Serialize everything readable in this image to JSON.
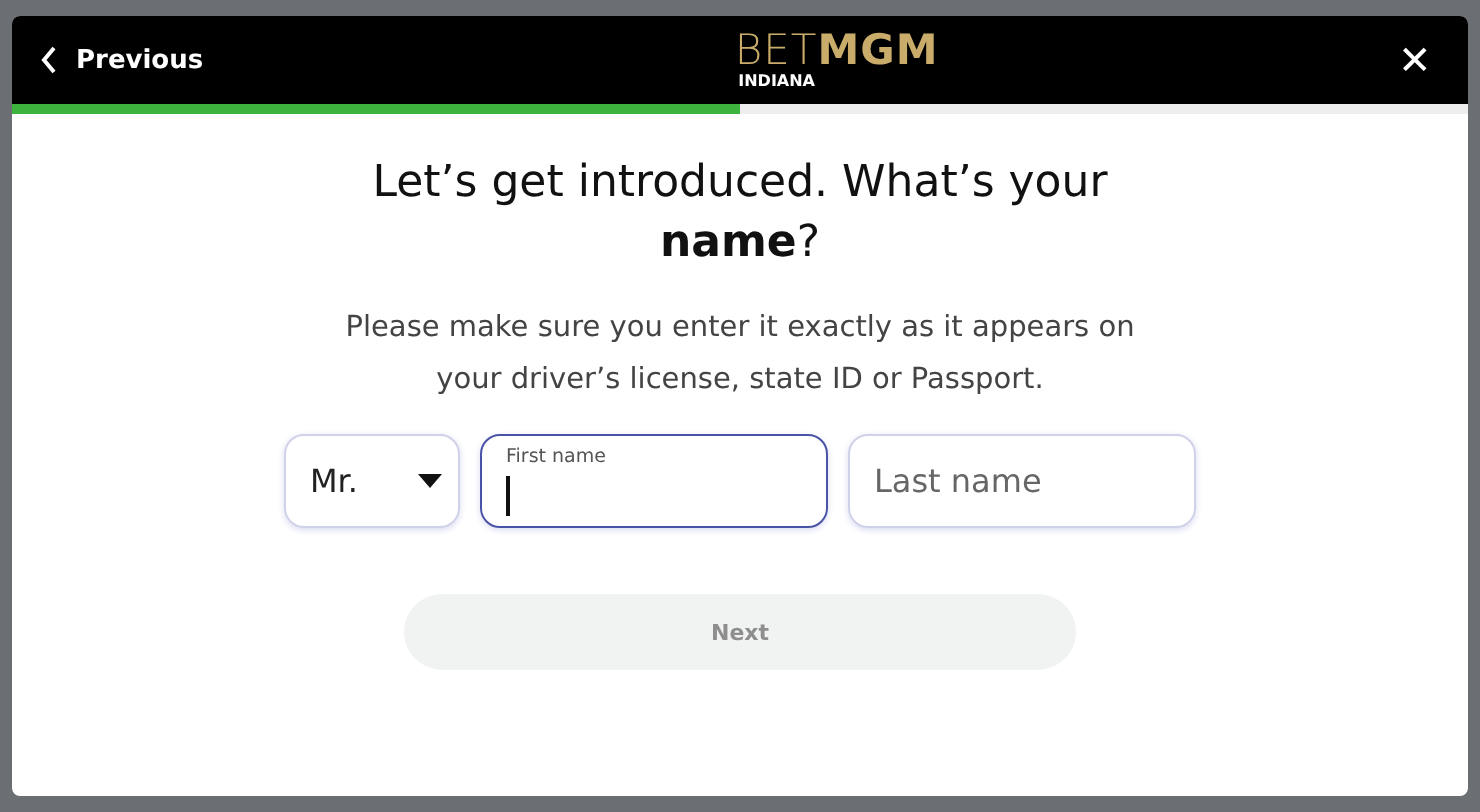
{
  "header": {
    "back_label": "Previous",
    "logo": "BET**MGM**",
    "region": "INDIANA",
    "close": "✕"
  },
  "progress": {
    "level": 0.5
  },
  "heading": "Let’s get introduced. What’s your **name**?",
  "subtext": "Please make sure you enter it exactly as it appears on your driver’s license, state ID or Passport.",
  "fields": [
    {
      "kind": "select",
      "value": "Mr.",
      "focused": false
    },
    {
      "kind": "text",
      "label": "First name",
      "focused": true
    },
    {
      "kind": "text",
      "placeholder": "Last name",
      "focused": false
    }
  ],
  "next": {
    "label": "Next",
    "disabled": true
  }
}
